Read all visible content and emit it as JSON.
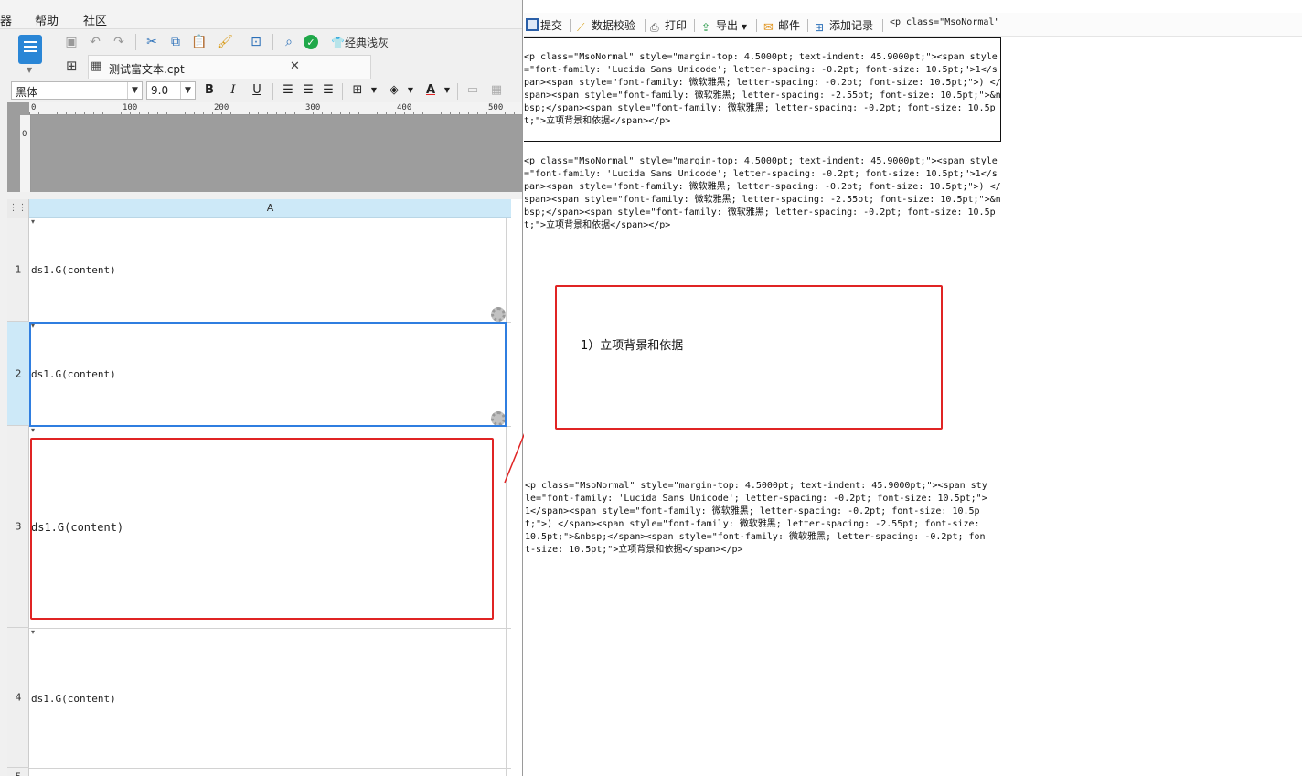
{
  "menu": {
    "items": [
      "器",
      "帮助",
      "社区"
    ]
  },
  "toolbar": {
    "classic_gray_label": "经典浅灰"
  },
  "file_tab": {
    "name": "测试富文本.cpt"
  },
  "format_bar": {
    "font_name": "黑体",
    "font_size": "9.0"
  },
  "ruler": {
    "labels": [
      "0",
      "100",
      "200",
      "300",
      "400",
      "500"
    ],
    "vlabel": "0"
  },
  "grid": {
    "column_header": "A",
    "rows": [
      {
        "number": "1",
        "content": "ds1.G(content)"
      },
      {
        "number": "2",
        "content": "ds1.G(content)"
      },
      {
        "number": "3",
        "content": "ds1.G(content)"
      },
      {
        "number": "4",
        "content": "ds1.G(content)"
      },
      {
        "number": "5",
        "content": ""
      }
    ]
  },
  "preview_toolbar": {
    "submit": "提交",
    "validate": "数据校验",
    "print": "打印",
    "export": "导出",
    "mail": "邮件",
    "add_record": "添加记录",
    "snippet": "<p class=\"MsoNormal\" style=\"margin-top:"
  },
  "preview": {
    "block1": "<p class=\"MsoNormal\" style=\"margin-top: 4.5000pt; text-indent: 45.9000pt;\"><span style=\"font-family: 'Lucida Sans Unicode'; letter-spacing: -0.2pt; font-size: 10.5pt;\">1</span><span style=\"font-family: 微软雅黑; letter-spacing: -0.2pt; font-size: 10.5pt;\">) </span><span style=\"font-family: 微软雅黑; letter-spacing: -2.55pt; font-size: 10.5pt;\">&nbsp;</span><span style=\"font-family: 微软雅黑; letter-spacing: -0.2pt; font-size: 10.5pt;\">立项背景和依据</span></p>",
    "block2": "<p class=\"MsoNormal\" style=\"margin-top: 4.5000pt; text-indent: 45.9000pt;\"><span style=\"font-family: 'Lucida Sans Unicode'; letter-spacing: -0.2pt; font-size: 10.5pt;\">1</span><span style=\"font-family: 微软雅黑; letter-spacing: -0.2pt; font-size: 10.5pt;\">) </span><span style=\"font-family: 微软雅黑; letter-spacing: -2.55pt; font-size: 10.5pt;\">&nbsp;</span><span style=\"font-family: 微软雅黑; letter-spacing: -0.2pt; font-size: 10.5pt;\">立项背景和依据</span></p>",
    "rendered": "1）立项背景和依据",
    "block4": "<p class=\"MsoNormal\" style=\"margin-top: 4.5000pt; text-indent: 45.9000pt;\"><span style=\"font-family: 'Lucida Sans Unicode'; letter-spacing: -0.2pt; font-size: 10.5pt;\">1</span><span style=\"font-family: 微软雅黑; letter-spacing: -0.2pt; font-size: 10.5pt;\">) </span><span style=\"font-family: 微软雅黑; letter-spacing: -2.55pt; font-size: 10.5pt;\">&nbsp;</span><span style=\"font-family: 微软雅黑; letter-spacing: -0.2pt; font-size: 10.5pt;\">立项背景和依据</span></p>"
  },
  "colors": {
    "accent_blue": "#2f7ee0",
    "highlight_red": "#e02424",
    "column_header_bg": "#cde9f8"
  }
}
